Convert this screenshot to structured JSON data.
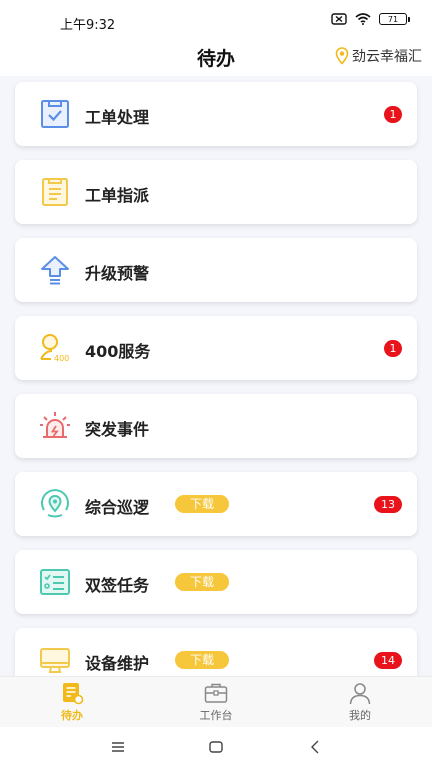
{
  "status_bar": {
    "time": "上午9:32",
    "battery": "71"
  },
  "header": {
    "title": "待办",
    "location": "劲云幸福汇"
  },
  "cards": [
    {
      "label": "工单处理",
      "icon": "clipboard-check-icon",
      "badge": "1",
      "download": null
    },
    {
      "label": "工单指派",
      "icon": "clipboard-list-icon",
      "badge": null,
      "download": null
    },
    {
      "label": "升级预警",
      "icon": "arrow-up-icon",
      "badge": null,
      "download": null
    },
    {
      "label": "400服务",
      "icon": "service-400-icon",
      "badge": "1",
      "download": null
    },
    {
      "label": "突发事件",
      "icon": "alarm-siren-icon",
      "badge": null,
      "download": null
    },
    {
      "label": "综合巡逻",
      "icon": "patrol-location-icon",
      "badge": "13",
      "download": "下载"
    },
    {
      "label": "双签任务",
      "icon": "checklist-icon",
      "badge": null,
      "download": "下载"
    },
    {
      "label": "设备维护",
      "icon": "monitor-icon",
      "badge": "14",
      "download": "下载"
    }
  ],
  "tabs": [
    {
      "label": "待办",
      "icon": "todo-icon",
      "active": true
    },
    {
      "label": "工作台",
      "icon": "toolbox-icon",
      "active": false
    },
    {
      "label": "我的",
      "icon": "user-icon",
      "active": false
    }
  ],
  "colors": {
    "accent": "#f2b91a",
    "badge": "#e8131b",
    "download_tag": "#f6c63b",
    "blue_icon": "#5b8ee6",
    "yellow_icon": "#f2c94c",
    "teal_icon": "#4cc9b0",
    "red_icon": "#e86a6a"
  }
}
